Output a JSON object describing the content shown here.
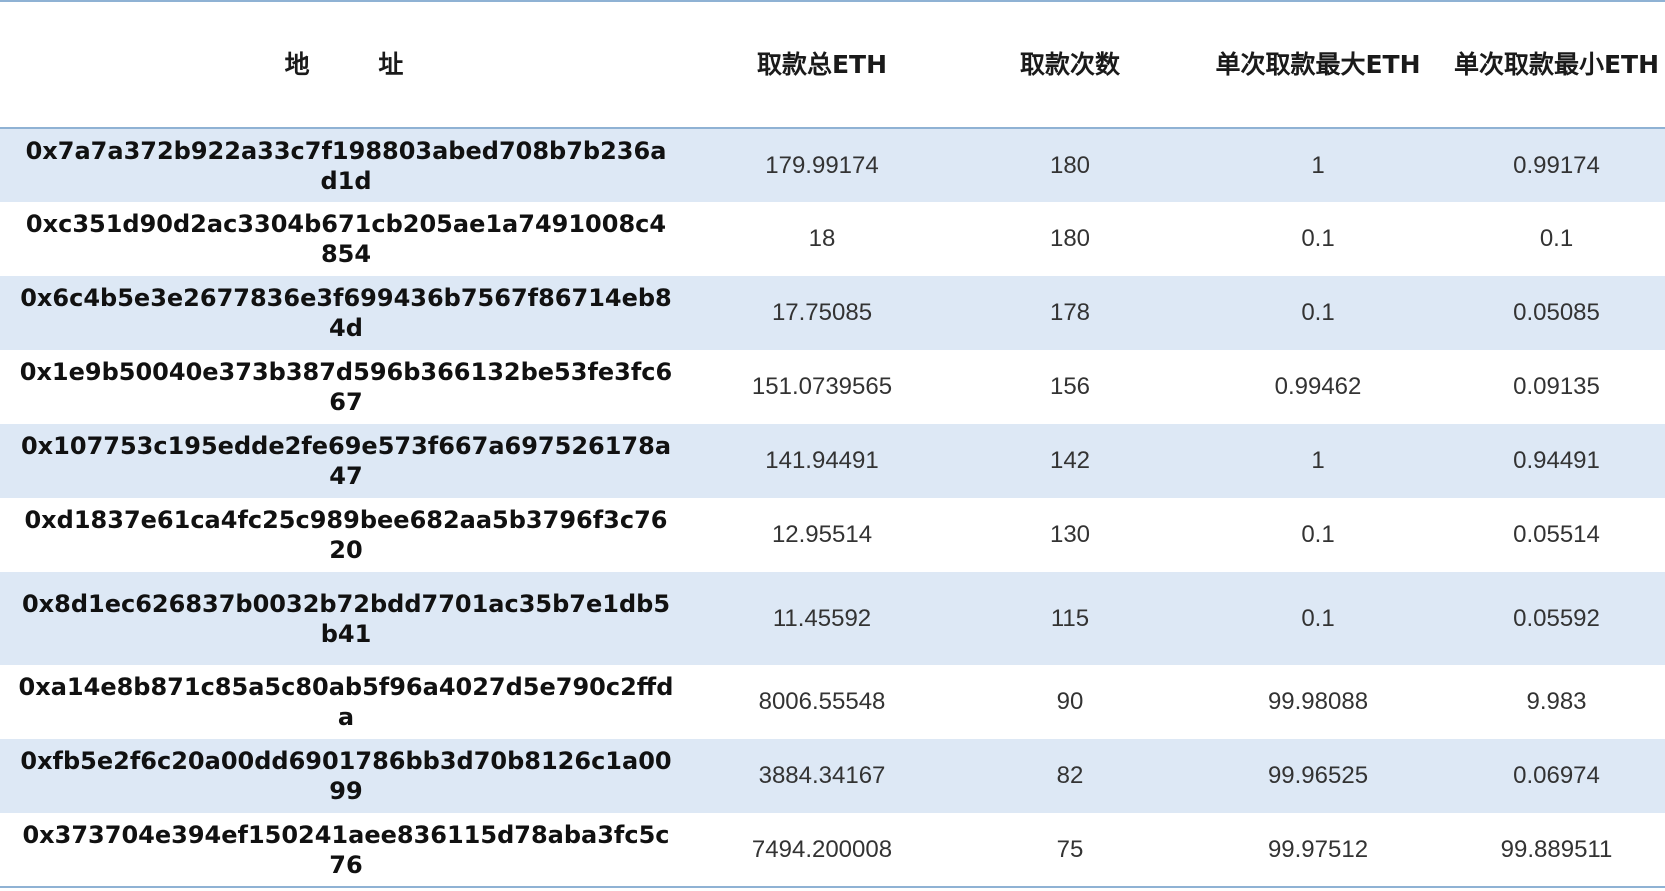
{
  "table": {
    "headers": {
      "address": "地 址",
      "total_eth": "取款总ETH",
      "count": "取款次数",
      "max_eth": "单次取款最大ETH",
      "min_eth": "单次取款最小ETH"
    },
    "rows": [
      {
        "address": "0x7a7a372b922a33c7f198803abed708b7b236ad1d",
        "total_eth": "179.99174",
        "count": "180",
        "max_eth": "1",
        "min_eth": "0.99174"
      },
      {
        "address": "0xc351d90d2ac3304b671cb205ae1a7491008c4854",
        "total_eth": "18",
        "count": "180",
        "max_eth": "0.1",
        "min_eth": "0.1"
      },
      {
        "address": "0x6c4b5e3e2677836e3f699436b7567f86714eb84d",
        "total_eth": "17.75085",
        "count": "178",
        "max_eth": "0.1",
        "min_eth": "0.05085"
      },
      {
        "address": "0x1e9b50040e373b387d596b366132be53fe3fc667",
        "total_eth": "151.0739565",
        "count": "156",
        "max_eth": "0.99462",
        "min_eth": "0.09135"
      },
      {
        "address": "0x107753c195edde2fe69e573f667a697526178a47",
        "total_eth": "141.94491",
        "count": "142",
        "max_eth": "1",
        "min_eth": "0.94491"
      },
      {
        "address": "0xd1837e61ca4fc25c989bee682aa5b3796f3c7620",
        "total_eth": "12.95514",
        "count": "130",
        "max_eth": "0.1",
        "min_eth": "0.05514"
      },
      {
        "address": "0x8d1ec626837b0032b72bdd7701ac35b7e1db5b41",
        "total_eth": "11.45592",
        "count": "115",
        "max_eth": "0.1",
        "min_eth": "0.05592"
      },
      {
        "address": "0xa14e8b871c85a5c80ab5f96a4027d5e790c2ffda",
        "total_eth": "8006.55548",
        "count": "90",
        "max_eth": "99.98088",
        "min_eth": "9.983"
      },
      {
        "address": "0xfb5e2f6c20a00dd6901786bb3d70b8126c1a0099",
        "total_eth": "3884.34167",
        "count": "82",
        "max_eth": "99.96525",
        "min_eth": "0.06974"
      },
      {
        "address": "0x373704e394ef150241aee836115d78aba3fc5c76",
        "total_eth": "7494.200008",
        "count": "75",
        "max_eth": "99.97512",
        "min_eth": "99.889511"
      }
    ]
  },
  "colors": {
    "stripe": "#dde8f5",
    "rule": "#8fb2d4"
  }
}
